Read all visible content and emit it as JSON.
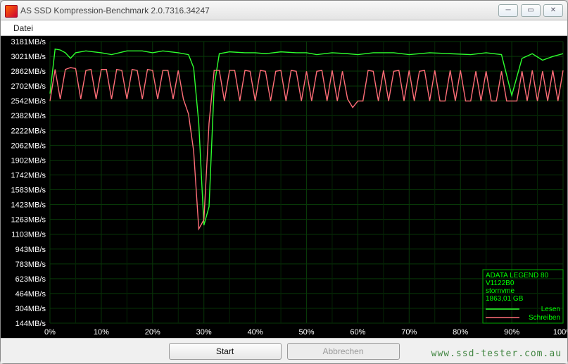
{
  "window": {
    "title": "AS SSD Kompression-Benchmark 2.0.7316.34247",
    "menu": {
      "datei": "Datei"
    }
  },
  "buttons": {
    "start": "Start",
    "abort": "Abbrechen"
  },
  "legend": {
    "device": "ADATA LEGEND 80",
    "firmware": "V1122B0",
    "driver": "stornvme",
    "capacity": "1863,01 GB",
    "read": "Lesen",
    "write": "Schreiben"
  },
  "watermark": "www.ssd-tester.com.au",
  "chart_data": {
    "type": "line",
    "xlabel": "",
    "ylabel": "",
    "x_ticks_pct": [
      0,
      10,
      20,
      30,
      40,
      50,
      60,
      70,
      80,
      90,
      100
    ],
    "y_ticks_mbs": [
      144,
      304,
      464,
      623,
      783,
      943,
      1103,
      1263,
      1423,
      1583,
      1742,
      1902,
      2062,
      2222,
      2382,
      2542,
      2702,
      2862,
      3021,
      3181
    ],
    "y_tick_unit": "MB/s",
    "xlim": [
      0,
      100
    ],
    "ylim": [
      144,
      3181
    ],
    "series": [
      {
        "name": "Lesen",
        "color": "#2eff2e",
        "x": [
          0,
          1,
          2,
          3,
          4,
          5,
          7,
          10,
          12,
          15,
          18,
          20,
          22,
          25,
          27,
          28,
          29,
          30,
          31,
          32,
          33,
          35,
          38,
          40,
          42,
          45,
          48,
          50,
          52,
          55,
          58,
          60,
          63,
          67,
          70,
          74,
          78,
          82,
          85,
          88,
          90,
          92,
          94,
          96,
          98,
          100
        ],
        "y": [
          2620,
          3100,
          3090,
          3060,
          3000,
          3060,
          3080,
          3060,
          3040,
          3080,
          3080,
          3060,
          3080,
          3060,
          3040,
          2900,
          2300,
          1200,
          1400,
          2700,
          3050,
          3070,
          3060,
          3060,
          3050,
          3070,
          3060,
          3060,
          3040,
          3060,
          3050,
          3040,
          3060,
          3060,
          3040,
          3060,
          3050,
          3040,
          3060,
          3040,
          2600,
          3000,
          3050,
          2980,
          3020,
          3050
        ]
      },
      {
        "name": "Schreiben",
        "color": "#ff6e78",
        "x": [
          0,
          1,
          2,
          3,
          4,
          5,
          6,
          7,
          8,
          9,
          10,
          11,
          12,
          13,
          14,
          15,
          16,
          17,
          18,
          19,
          20,
          21,
          22,
          23,
          24,
          25,
          26,
          27,
          28,
          29,
          30,
          31,
          32,
          33,
          34,
          35,
          36,
          37,
          38,
          39,
          40,
          41,
          42,
          43,
          44,
          45,
          46,
          47,
          48,
          49,
          50,
          51,
          52,
          53,
          54,
          55,
          56,
          57,
          58,
          59,
          60,
          61,
          62,
          63,
          64,
          65,
          66,
          67,
          68,
          69,
          70,
          71,
          72,
          73,
          74,
          75,
          76,
          77,
          78,
          79,
          80,
          81,
          82,
          83,
          84,
          85,
          86,
          87,
          88,
          89,
          90,
          91,
          92,
          93,
          94,
          95,
          96,
          97,
          98,
          99,
          100
        ],
        "y": [
          2540,
          2880,
          2560,
          2880,
          2900,
          2890,
          2560,
          2870,
          2880,
          2560,
          2880,
          2880,
          2560,
          2880,
          2870,
          2560,
          2880,
          2870,
          2560,
          2880,
          2870,
          2560,
          2870,
          2870,
          2560,
          2870,
          2560,
          2400,
          2000,
          1160,
          1260,
          2300,
          2870,
          2870,
          2540,
          2870,
          2870,
          2540,
          2870,
          2860,
          2540,
          2870,
          2860,
          2540,
          2860,
          2870,
          2540,
          2870,
          2860,
          2540,
          2860,
          2540,
          2860,
          2870,
          2540,
          2870,
          2540,
          2860,
          2560,
          2470,
          2540,
          2540,
          2870,
          2860,
          2540,
          2870,
          2540,
          2860,
          2870,
          2540,
          2870,
          2540,
          2860,
          2870,
          2540,
          2870,
          2540,
          2540,
          2870,
          2540,
          2870,
          2540,
          2540,
          2860,
          2540,
          2860,
          2540,
          2540,
          2860,
          2540,
          2540,
          2540,
          2860,
          2540,
          2870,
          2540,
          2860,
          2540,
          2870,
          2540,
          2870
        ]
      }
    ]
  }
}
